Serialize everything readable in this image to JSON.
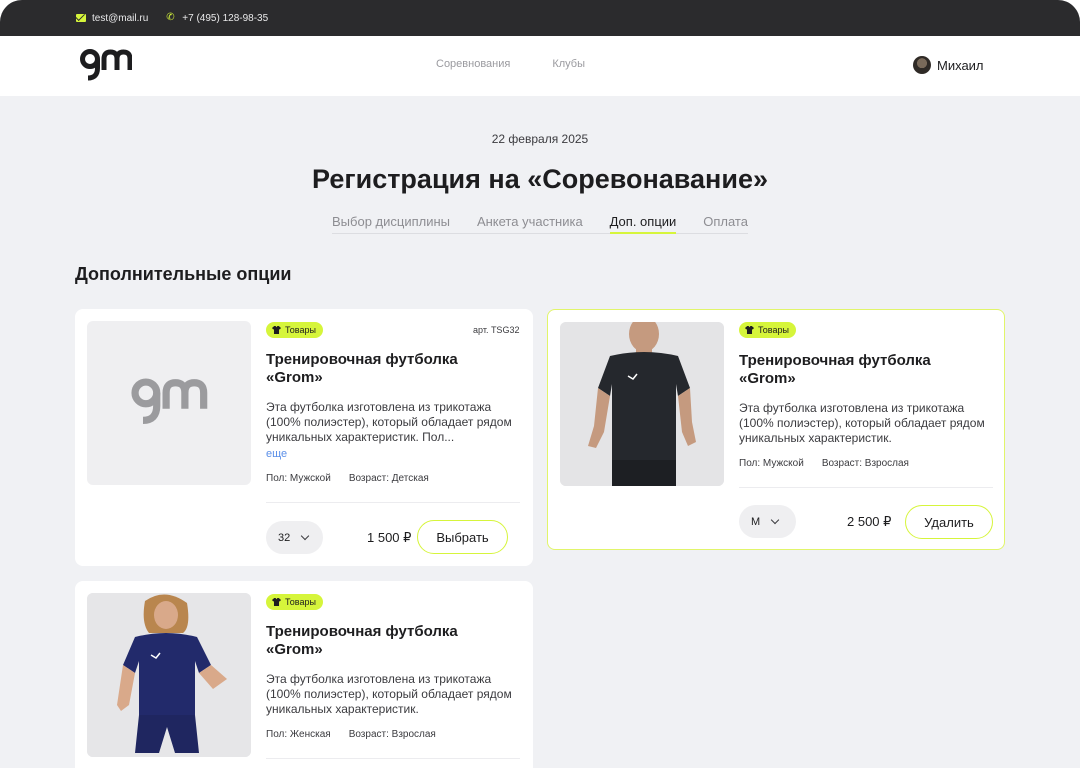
{
  "colors": {
    "accent": "#d6f53b",
    "topbar": "#2b2b2d",
    "bg": "#f0f1f4",
    "link": "#5b8fe8"
  },
  "topbar": {
    "email": "test@mail.ru",
    "phone": "+7 (495) 128-98-35"
  },
  "header": {
    "logo_text": "gm",
    "nav": [
      "Соревнования",
      "Клубы"
    ],
    "user_name": "Михаил"
  },
  "page": {
    "date": "22 февраля 2025",
    "title": "Регистрация на «Соревонавание»",
    "steps": [
      "Выбор дисциплины",
      "Анкета участника",
      "Доп. опции",
      "Оплата"
    ],
    "active_step": "Доп. опции",
    "section_title": "Дополнительные опции"
  },
  "products": [
    {
      "badge": "Товары",
      "article": "арт. TSG32",
      "name": "Тренировочная футболка «Grom»",
      "description": "Эта футболка изготовлена из трикотажа (100% полиэстер), который обладает рядом уникальных характеристик. Пол...",
      "more": "еще",
      "gender": "Пол: Мужской",
      "age": "Возраст: Детская",
      "size": "32",
      "price": "1 500 ₽",
      "button": "Выбрать",
      "image": "logo-placeholder"
    },
    {
      "badge": "Товары",
      "name": "Тренировочная футболка «Grom»",
      "description": "Эта футболка изготовлена из трикотажа (100% полиэстер), который обладает рядом уникальных характеристик.",
      "gender": "Пол: Мужской",
      "age": "Возраст: Взрослая",
      "size": "M",
      "price": "2 500 ₽",
      "button": "Удалить",
      "selected": true,
      "image": "male-model-black-tshirt"
    },
    {
      "badge": "Товары",
      "name": "Тренировочная футболка «Grom»",
      "description": "Эта футболка изготовлена из трикотажа (100% полиэстер), который обладает рядом уникальных характеристик.",
      "gender": "Пол: Женская",
      "age": "Возраст: Взрослая",
      "image": "female-model-navy-tshirt"
    }
  ]
}
